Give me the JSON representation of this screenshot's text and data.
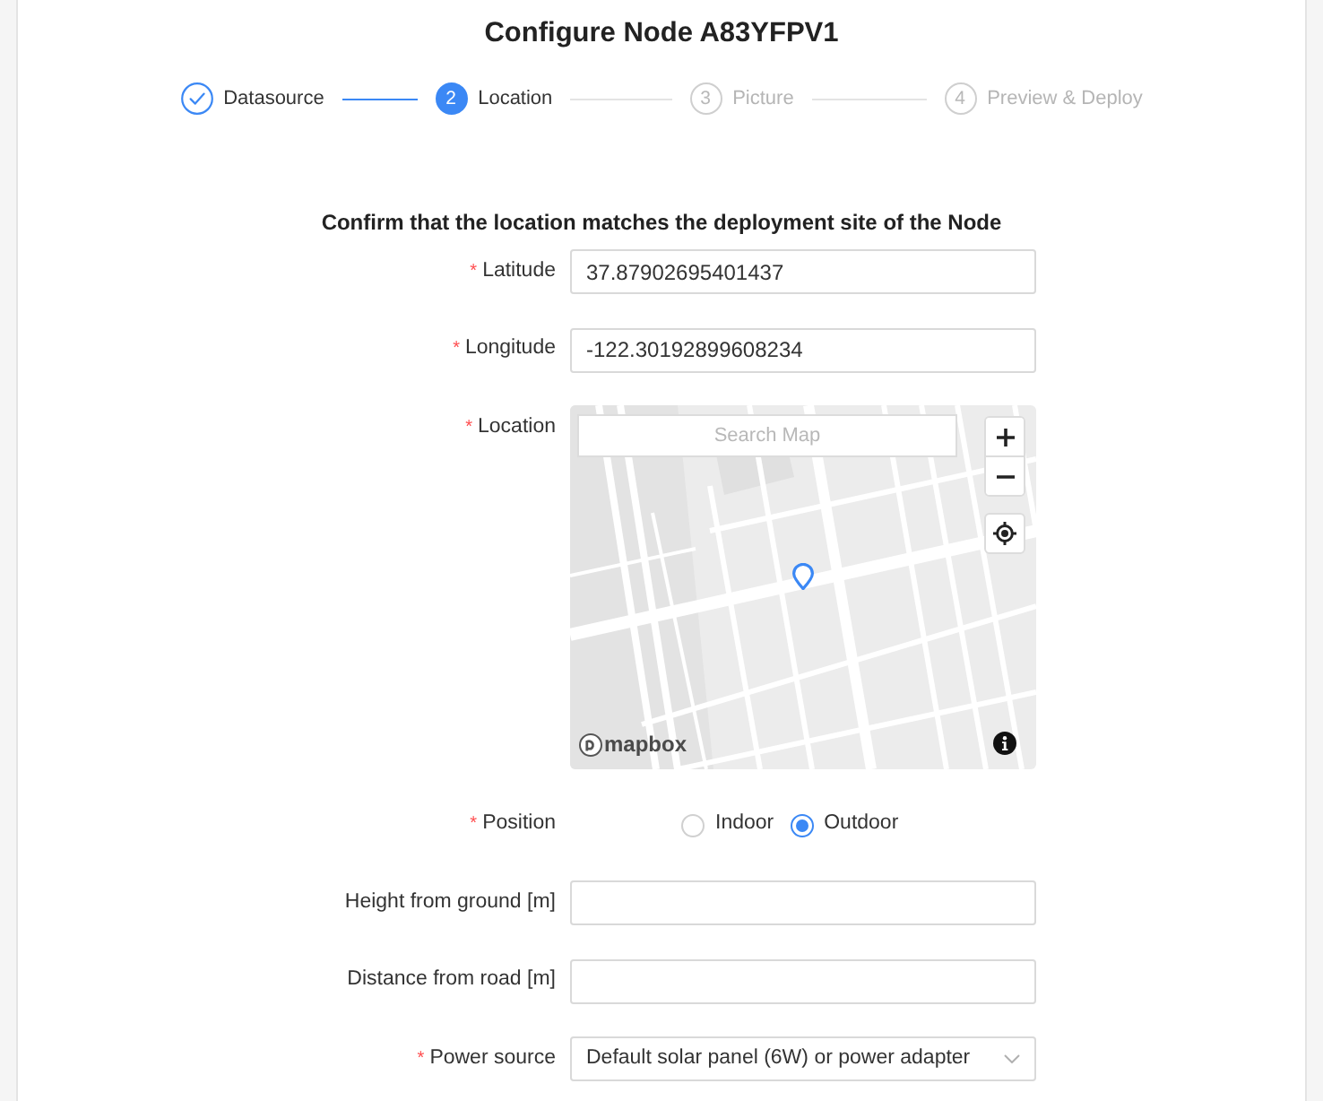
{
  "title": "Configure Node A83YFPV1",
  "steps": [
    {
      "label": "Datasource",
      "completed": true,
      "selected": false
    },
    {
      "number": "2",
      "label": "Location",
      "completed": false,
      "selected": true
    },
    {
      "number": "3",
      "label": "Picture",
      "completed": false,
      "selected": false
    },
    {
      "number": "4",
      "label": "Preview & Deploy",
      "completed": false,
      "selected": false
    }
  ],
  "form": {
    "heading": "Confirm that the location matches the deployment site of the Node",
    "fields": [
      {
        "kind": "text",
        "required_mark": "*",
        "label": "Latitude",
        "value": "37.87902695401437"
      },
      {
        "kind": "text",
        "required_mark": "*",
        "label": "Longitude",
        "value": "-122.30192899608234"
      },
      {
        "kind": "map",
        "required_mark": "*",
        "label": "Location",
        "map": {
          "search": {
            "placeholder": "Search Map"
          },
          "logo_text": "mapbox"
        }
      },
      {
        "kind": "radio",
        "required_mark": "*",
        "label": "Position",
        "options": [
          {
            "label": "Indoor",
            "selected": false
          },
          {
            "label": "Outdoor",
            "selected": true
          }
        ]
      },
      {
        "kind": "text",
        "label": "Height from ground [m]"
      },
      {
        "kind": "text",
        "label": "Distance from road [m]"
      },
      {
        "kind": "select",
        "required_mark": "*",
        "label": "Power source",
        "value": "Default solar panel (6W) or power adapter"
      }
    ]
  }
}
